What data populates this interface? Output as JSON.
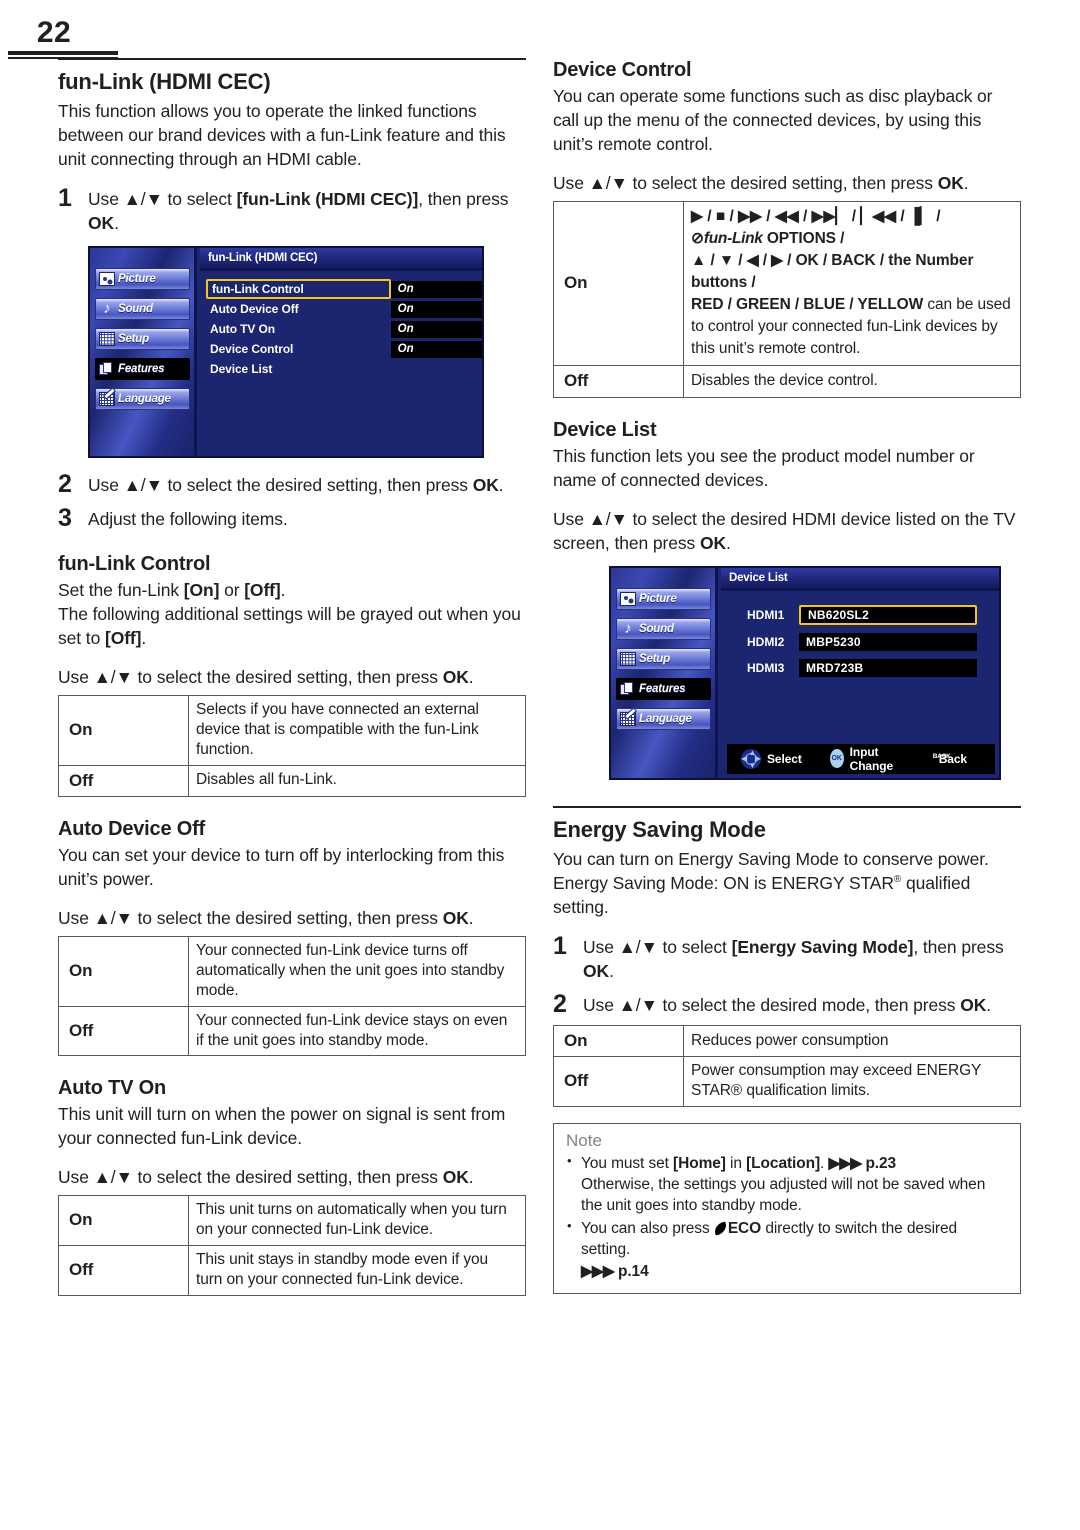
{
  "page": {
    "number": "22"
  },
  "left_column": {
    "section_title": "fun-Link (HDMI CEC)",
    "intro": "This function allows you to operate the linked functions between our brand devices with a fun-Link feature and this unit connecting through an HDMI cable.",
    "step1_num": "1",
    "step1_text_a": "Use ▲/▼ to select ",
    "step1_text_b": "[fun-Link (HDMI CEC)]",
    "step1_text_c": ", then press ",
    "step1_text_d": "OK",
    "step1_text_e": ".",
    "step2_num": "2",
    "step2_text_a": "Use ▲/▼ to select the desired setting, then press ",
    "step2_text_b": "OK",
    "step2_text_c": ".",
    "step3_num": "3",
    "step3_text": "Adjust the following items.",
    "osd": {
      "title": "fun-Link (HDMI CEC)",
      "sidebar": [
        {
          "label": "Picture",
          "icon": "picture-icon",
          "active": false
        },
        {
          "label": "Sound",
          "icon": "sound-icon",
          "active": false
        },
        {
          "label": "Setup",
          "icon": "setup-icon",
          "active": false
        },
        {
          "label": "Features",
          "icon": "features-icon",
          "active": true
        },
        {
          "label": "Language",
          "icon": "language-icon",
          "active": false
        }
      ],
      "rows": [
        {
          "label": "fun-Link Control",
          "value": "On",
          "selected": true
        },
        {
          "label": "Auto Device Off",
          "value": "On",
          "selected": false
        },
        {
          "label": "Auto TV On",
          "value": "On",
          "selected": false
        },
        {
          "label": "Device Control",
          "value": "On",
          "selected": false
        },
        {
          "label": "Device List",
          "value": "",
          "selected": false
        }
      ]
    },
    "funlink_control": {
      "title": "fun-Link Control",
      "line1_a": "Set the fun-Link ",
      "line1_b": "[On]",
      "line1_c": " or ",
      "line1_d": "[Off]",
      "line1_e": ".",
      "line2_a": "The following additional settings will be grayed out when you set to ",
      "line2_b": "[Off]",
      "line2_c": ".",
      "use_line_a": "Use ▲/▼ to select the desired setting, then press ",
      "use_line_b": "OK",
      "use_line_c": ".",
      "table": [
        {
          "key": "On",
          "desc": "Selects if you have connected an external device that is compatible with the fun-Link function."
        },
        {
          "key": "Off",
          "desc": "Disables all fun-Link."
        }
      ]
    },
    "auto_device_off": {
      "title": "Auto Device Off",
      "body": "You can set your device to turn off by interlocking from this unit’s power.",
      "use_line_a": "Use ▲/▼ to select the desired setting, then press ",
      "use_line_b": "OK",
      "use_line_c": ".",
      "table": [
        {
          "key": "On",
          "desc": "Your connected fun-Link device turns off automatically when the unit goes into standby mode."
        },
        {
          "key": "Off",
          "desc": "Your connected fun-Link device stays on even if the unit goes into standby mode."
        }
      ]
    },
    "auto_tv_on": {
      "title": "Auto TV On",
      "body": "This unit will turn on when the power on signal is sent from your connected fun-Link device.",
      "use_line_a": "Use ▲/▼ to select the desired setting, then press ",
      "use_line_b": "OK",
      "use_line_c": ".",
      "table": [
        {
          "key": "On",
          "desc": "This unit turns on automatically when you turn on your connected fun-Link device."
        },
        {
          "key": "Off",
          "desc": "This unit stays in standby mode even if you turn on your connected fun-Link device."
        }
      ]
    }
  },
  "right_column": {
    "device_control": {
      "title": "Device Control",
      "body": "You can operate some functions such as disc playback or call up the menu of the connected devices, by using this unit’s remote control.",
      "use_line_a": "Use ▲/▼ to select the desired setting, then press ",
      "use_line_b": "OK",
      "use_line_c": ".",
      "on_key": "On",
      "on_glyph_line": "▶ / ■ / ▶▶ / ◀◀ / ▶▶▏ / ▏◀◀ / ▐▏ /",
      "on_logo_prefix": "⊘",
      "on_logo": "fun-Link",
      "on_logo_suffix": "OPTIONS /",
      "on_keys_line": "▲ / ▼ / ◀ / ▶ / OK / BACK / the Number buttons /",
      "on_colors_line": "RED / GREEN / BLUE / YELLOW",
      "on_tail": " can be used to control your connected fun-Link devices by this unit’s remote control.",
      "off_key": "Off",
      "off_desc": "Disables the device control."
    },
    "device_list": {
      "title": "Device List",
      "body": "This function lets you see the product model number or name of connected devices.",
      "use_line_a": "Use ▲/▼ to select the desired HDMI device listed on the TV screen, then press ",
      "use_line_b": "OK",
      "use_line_c": ".",
      "osd": {
        "title": "Device List",
        "sidebar": [
          {
            "label": "Picture",
            "icon": "picture-icon",
            "active": false
          },
          {
            "label": "Sound",
            "icon": "sound-icon",
            "active": false
          },
          {
            "label": "Setup",
            "icon": "setup-icon",
            "active": false
          },
          {
            "label": "Features",
            "icon": "features-icon",
            "active": true
          },
          {
            "label": "Language",
            "icon": "language-icon",
            "active": false
          }
        ],
        "rows": [
          {
            "key": "HDMI1",
            "value": "NB620SL2",
            "selected": true
          },
          {
            "key": "HDMI2",
            "value": "MBP5230",
            "selected": false
          },
          {
            "key": "HDMI3",
            "value": "MRD723B",
            "selected": false
          }
        ],
        "footer": [
          {
            "icon": "dpad-icon",
            "label": "Select"
          },
          {
            "icon": "ok-button-icon",
            "label": "Input Change"
          },
          {
            "icon": "back-button-icon",
            "label": "Back",
            "cap": "BACK"
          }
        ]
      }
    },
    "energy_saving": {
      "title": "Energy Saving Mode",
      "body_line1": "You can turn on Energy Saving Mode to conserve power.",
      "body_line2_a": "Energy Saving Mode: ON is ENERGY STAR",
      "body_line2_sup": "®",
      "body_line2_b": " qualified setting.",
      "step1_num": "1",
      "step1_a": "Use ▲/▼ to select ",
      "step1_b": "[Energy Saving Mode]",
      "step1_c": ", then press ",
      "step1_d": "OK",
      "step1_e": ".",
      "step2_num": "2",
      "step2_a": "Use ▲/▼ to select the desired mode, then press ",
      "step2_b": "OK",
      "step2_c": ".",
      "table": [
        {
          "key": "On",
          "desc": "Reduces power consumption"
        },
        {
          "key": "Off",
          "desc": "Power consumption may exceed ENERGY STAR® qualification limits."
        }
      ],
      "note": {
        "title": "Note",
        "item1_a": "You must set ",
        "item1_b": "[Home]",
        "item1_c": " in ",
        "item1_d": "[Location]",
        "item1_e": ". ",
        "item1_ref": "p.23",
        "item1_cont": "Otherwise, the settings you adjusted will not be saved when the unit goes into standby mode.",
        "item2_a": "You can also press ",
        "item2_b": "ECO",
        "item2_c": " directly to switch the desired setting.",
        "item2_ref": "p.14"
      }
    }
  }
}
